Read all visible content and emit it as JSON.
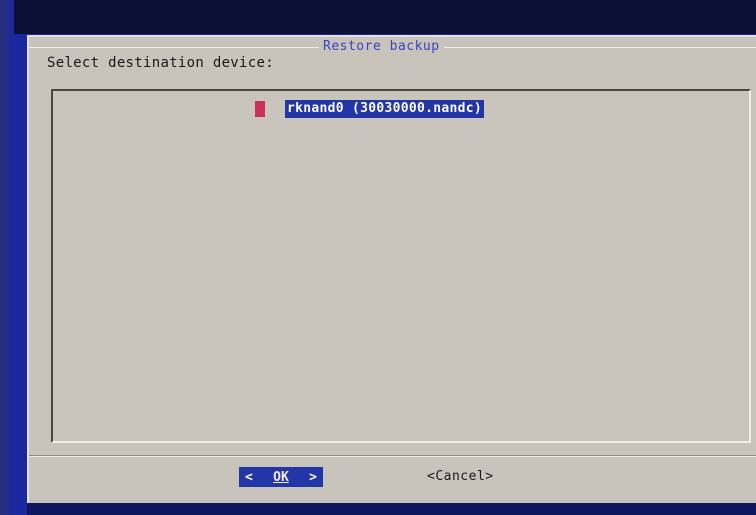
{
  "dialog": {
    "title": "Restore backup",
    "prompt": "Select destination device:"
  },
  "list": {
    "items": [
      {
        "tag": "0",
        "label": "rknand0 (30030000.nandc)",
        "selected": true
      }
    ]
  },
  "buttons": {
    "ok_left": "<",
    "ok_label": "OK",
    "ok_right": ">",
    "cancel_label": "<Cancel>"
  },
  "colors": {
    "background": "#1a279e",
    "dialog": "#c8c3bb",
    "highlight": "#2236a8",
    "title": "#3b44c4",
    "tag": "#cc2f5c"
  }
}
